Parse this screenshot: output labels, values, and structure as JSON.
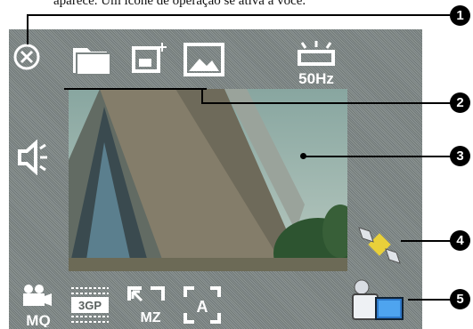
{
  "caption": "aparece. Um ícone de operação se ativa a você.",
  "top_icons": [
    {
      "name": "close-icon",
      "interactable": true
    },
    {
      "name": "folder-icon",
      "interactable": true
    },
    {
      "name": "capture-mode-icon",
      "interactable": true
    },
    {
      "name": "image-icon",
      "interactable": true
    },
    {
      "name": "flicker-50hz-icon",
      "interactable": true
    }
  ],
  "flicker_label": "50Hz",
  "bottom_icons": [
    {
      "name": "video-quality-mq-icon",
      "label": "MQ"
    },
    {
      "name": "format-3gp-icon",
      "label": "3GP"
    },
    {
      "name": "zoom-mz-icon",
      "label": "MZ"
    },
    {
      "name": "auto-scene-icon",
      "label": "A"
    }
  ],
  "callouts": [
    "1",
    "2",
    "3",
    "4",
    "5"
  ]
}
